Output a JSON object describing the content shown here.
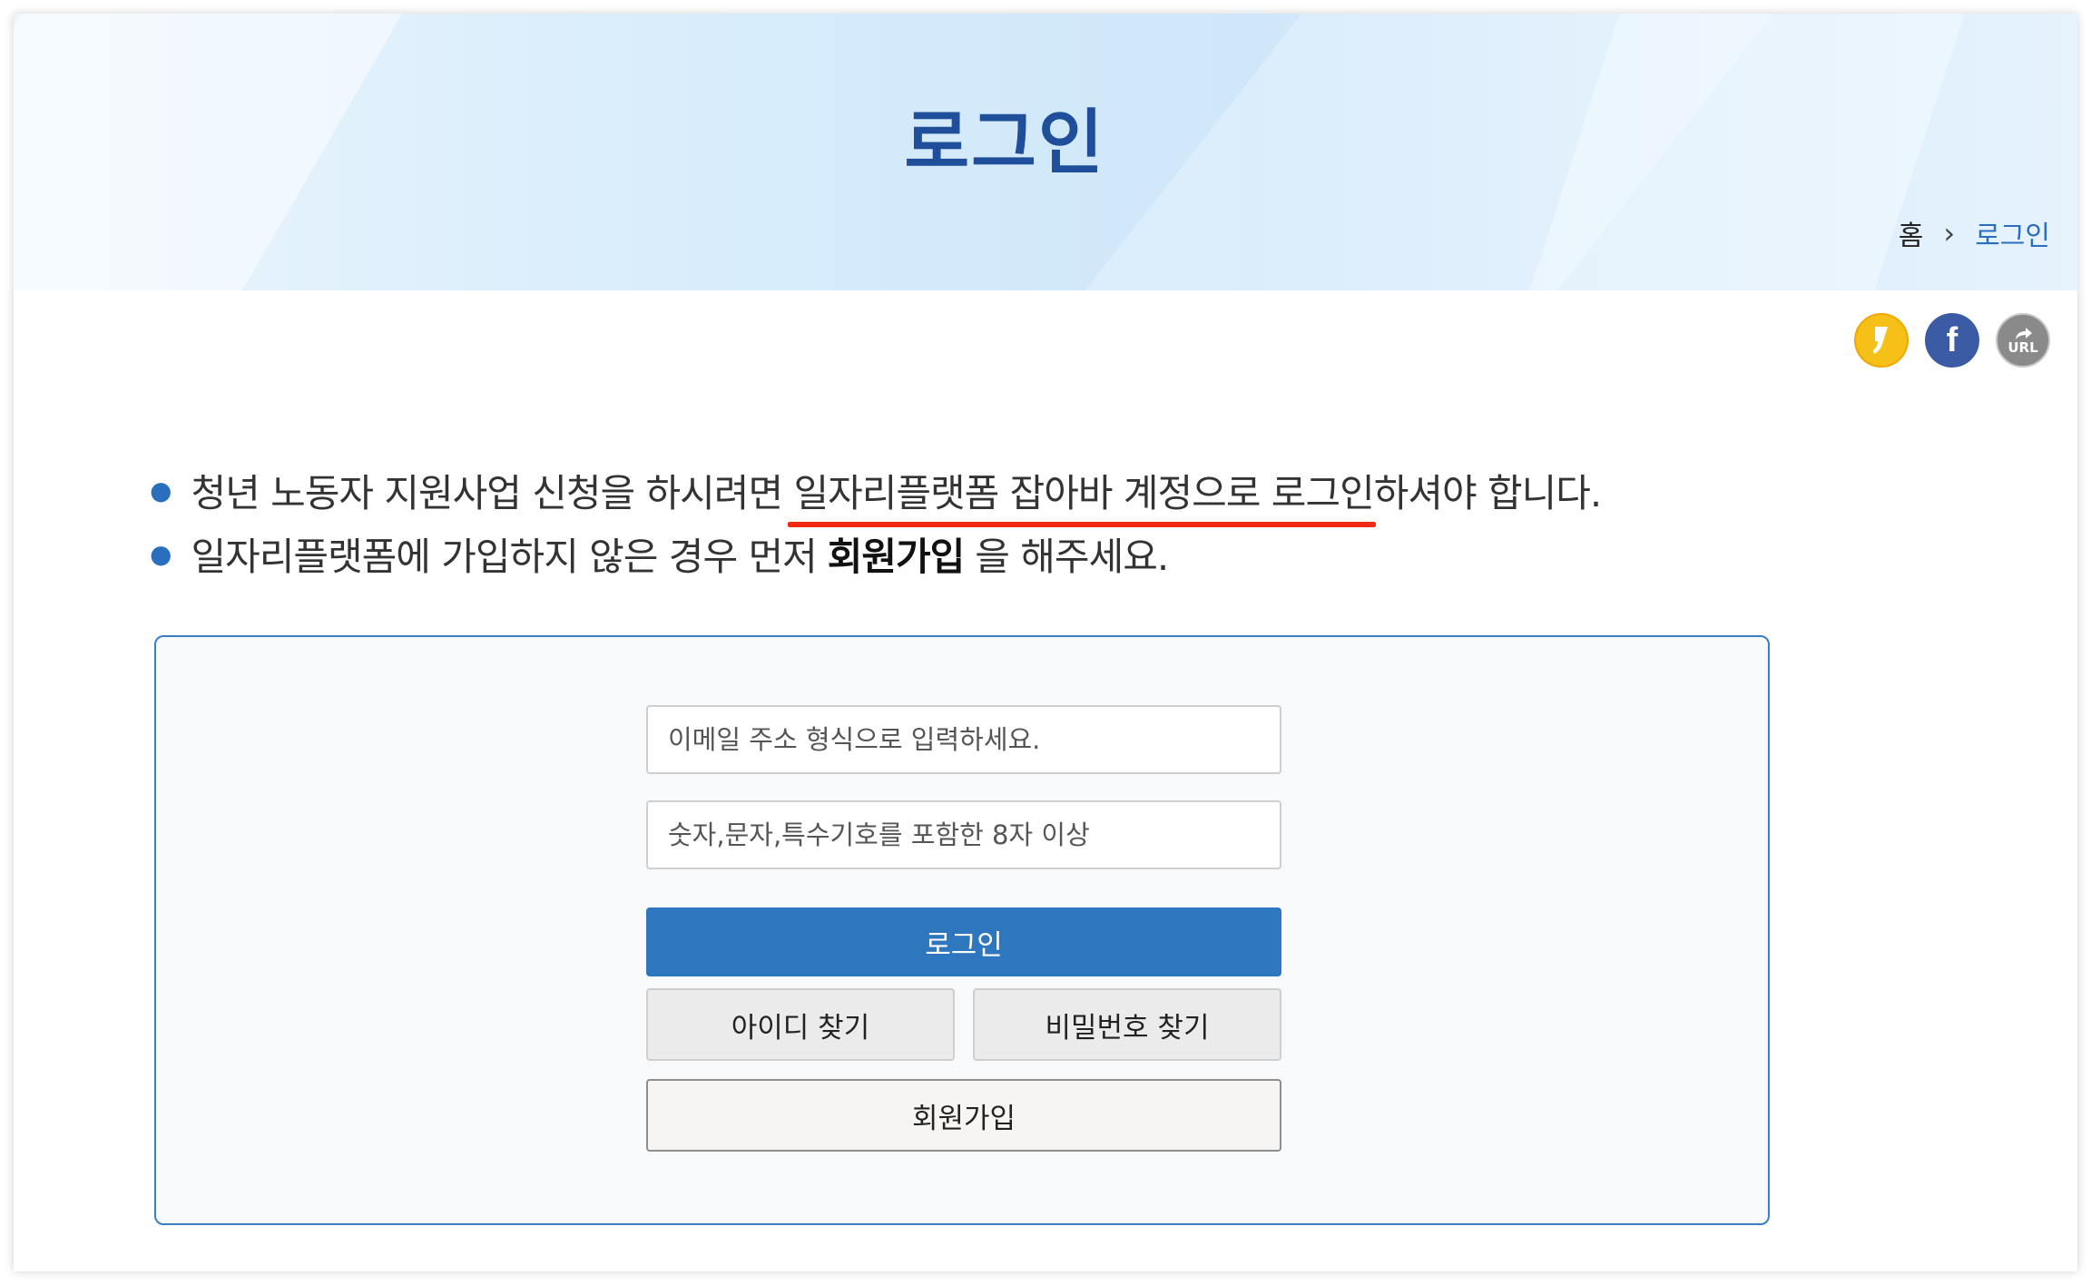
{
  "header": {
    "title": "로그인",
    "breadcrumb": {
      "home": "홈",
      "separator": "›",
      "current": "로그인"
    }
  },
  "share": {
    "kakao_icon": "kakao-story-icon",
    "facebook_icon": "facebook-icon",
    "facebook_glyph": "f",
    "url_icon": "url-share-icon",
    "url_label": "URL"
  },
  "notices": {
    "line1": {
      "before": "청년 노동자 지원사업 신청을 하시려면 ",
      "highlight": "일자리플랫폼 잡아바 계정으로 로그인",
      "after": "하셔야 합니다."
    },
    "line2": {
      "before": "일자리플랫폼에 가입하지 않은 경우 먼저",
      "strong": "회원가입",
      "after": "을 해주세요."
    }
  },
  "form": {
    "email_placeholder": "이메일 주소 형식으로 입력하세요.",
    "password_placeholder": "숫자,문자,특수기호를 포함한 8자 이상",
    "login_label": "로그인",
    "find_id_label": "아이디 찾기",
    "find_pw_label": "비밀번호 찾기",
    "join_label": "회원가입"
  },
  "colors": {
    "title": "#1f4e9a",
    "accent": "#2e76bd",
    "underline": "#ee2a12",
    "kakao": "#f5c118",
    "facebook": "#3b5ba4"
  }
}
